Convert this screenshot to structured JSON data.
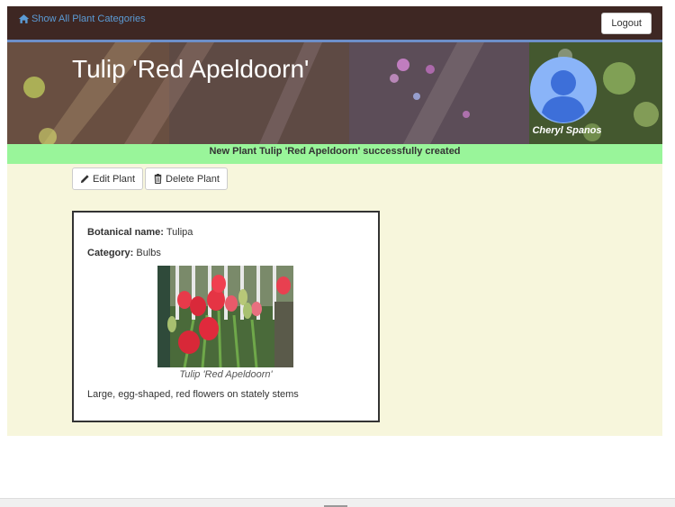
{
  "nav": {
    "show_all_label": "Show All Plant Categories",
    "logout_label": "Logout"
  },
  "header": {
    "title": "Tulip 'Red Apeldoorn'",
    "user_name": "Cheryl Spanos"
  },
  "alert": {
    "message": "New Plant Tulip 'Red Apeldoorn' successfully created"
  },
  "actions": {
    "edit_label": "Edit Plant",
    "delete_label": "Delete Plant"
  },
  "plant": {
    "botanical_label": "Botanical name:",
    "botanical_value": "Tulipa",
    "category_label": "Category:",
    "category_value": "Bulbs",
    "caption": "Tulip 'Red Apeldoorn'",
    "description": "Large, egg-shaped, red flowers on stately stems"
  },
  "icons": {
    "home": "home-icon",
    "edit": "pencil-icon",
    "delete": "trash-icon",
    "avatar": "user-avatar-icon"
  },
  "colors": {
    "topbar": "#3e2723",
    "link": "#5b9bd5",
    "alert_bg": "#99f59a",
    "content_bg": "#f7f6dc",
    "avatar_bg": "#8ab4f8",
    "avatar_fg": "#3d6fd9"
  }
}
